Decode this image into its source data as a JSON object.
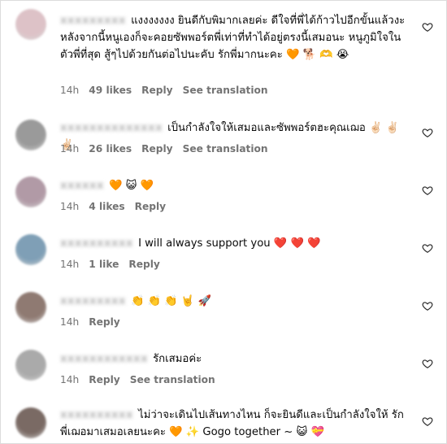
{
  "comments": [
    {
      "username": "xxxxxxxxx",
      "text": "แงงงงงงง ยินดีกับพิมากเลยค่ะ ดีใจที่พี่ได้ก้าวไปอีกขั้นแล้วงะ หลังจากนี้หนูเองก็จะคอยซัพพอร์ตพี่เท่าที่ทำได้อยู่ตรงนี้เสมอนะ หนูภูมิใจในตัวพี่ที่สุด สู้ๆไปด้วยกันต่อไปนะคับ รักพี่มากนะคะ 🧡 🐕 🫶 😭",
      "time": "14h",
      "likes": "49 likes",
      "reply": "Reply",
      "translation": "See translation",
      "avatar_color": "#ddc2c7"
    },
    {
      "username": "xxxxxxxxxxxxxx",
      "text": "เป็นกำลังใจให้เสมอและซัพพอร์ตฮะคุณเฌอ ✌🏻 ✌🏻 ✌🏻",
      "time": "14h",
      "likes": "26 likes",
      "reply": "Reply",
      "translation": "See translation",
      "avatar_color": "#9a9a9a"
    },
    {
      "username": "xxxxxx",
      "text": "🧡 😺 🧡",
      "time": "14h",
      "likes": "4 likes",
      "reply": "Reply",
      "translation": "",
      "avatar_color": "#b19aa6"
    },
    {
      "username": "xxxxxxxxxx",
      "text": "I will always support you ❤️ ❤️ ❤️",
      "time": "14h",
      "likes": "1 like",
      "reply": "Reply",
      "translation": "",
      "avatar_color": "#7f9fb6"
    },
    {
      "username": "xxxxxxxxx",
      "text": "👏 👏 👏 🤘 🚀",
      "time": "14h",
      "likes": "",
      "reply": "Reply",
      "translation": "",
      "avatar_color": "#8f7a72"
    },
    {
      "username": "xxxxxxxxxxxx",
      "text": "รักเสมอค่ะ",
      "time": "14h",
      "likes": "",
      "reply": "Reply",
      "translation": "See translation",
      "avatar_color": "#aaaaaa"
    },
    {
      "username": "xxxxxxxxxx",
      "text": "ไม่ว่าจะเดินไปเส้นทางไหน ก็จะยินดีและเป็นกำลังใจให้ รักพี่เฌอมาเสมอเลยนะคะ 🧡 ✨ Gogo together ~ 😺 💝",
      "time": "",
      "likes": "",
      "reply": "",
      "translation": "",
      "avatar_color": "#7a6a64"
    }
  ]
}
